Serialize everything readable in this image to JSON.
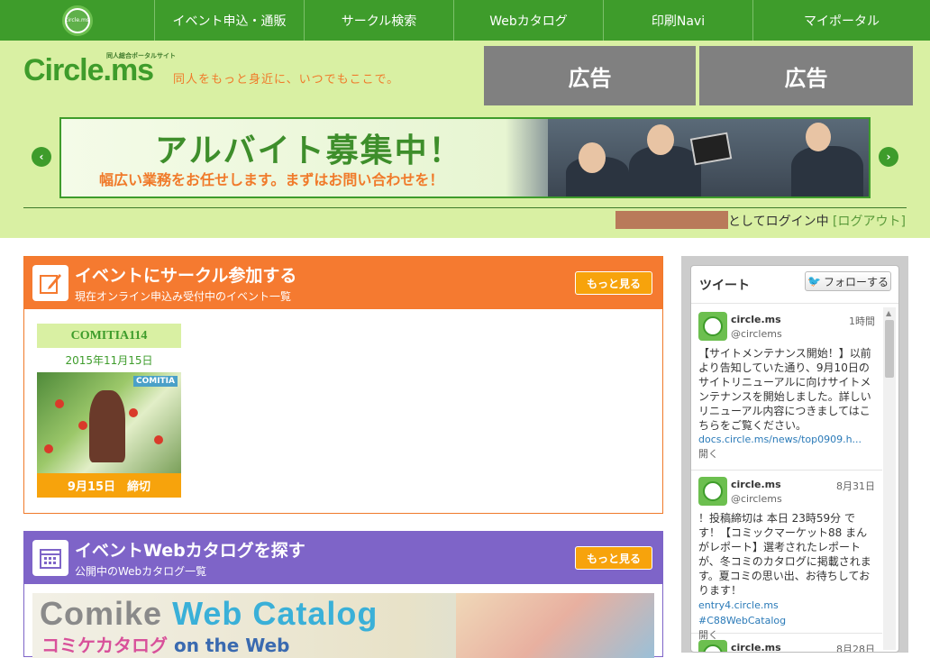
{
  "nav": {
    "logo_text": "circle.ms",
    "items": [
      {
        "label": "イベント申込・通販"
      },
      {
        "label": "サークル検索"
      },
      {
        "label": "Webカタログ"
      },
      {
        "label": "印刷Navi"
      },
      {
        "label": "マイポータル"
      }
    ]
  },
  "header": {
    "site_name": "Circle.ms",
    "site_sub": "同人総合ポータルサイト",
    "tagline": "同人をもっと身近に、いつでもここで。",
    "ads": [
      "広告",
      "広告"
    ],
    "banner_title": "アルバイト募集中！",
    "banner_sub": "幅広い業務をお任せします。まずはお問い合わせを！",
    "prev_arrow": "‹",
    "next_arrow": "›",
    "login_suffix": "としてログイン中",
    "logout_label": "[ログアウト]"
  },
  "event_section": {
    "title": "イベントにサークル参加する",
    "desc": "現在オンライン申込み受付中のイベント一覧",
    "more_label": "もっと見る",
    "event": {
      "name": "COMITIA114",
      "date": "2015年11月15日",
      "image_label": "COMITIA",
      "deadline": "9月15日　締切"
    }
  },
  "catalog_section": {
    "title": "イベントWebカタログを探す",
    "desc": "公開中のWebカタログ一覧",
    "more_label": "もっと見る",
    "banner_word1": "Comike",
    "banner_word2": "Web Catalog",
    "banner_sub1": "コミケカタログ",
    "banner_sub2": "on the Web"
  },
  "twitter": {
    "title": "ツイート",
    "follow_label": "フォローする",
    "tweets": [
      {
        "name": "circle.ms",
        "handle": "@circlems",
        "time": "1時間",
        "text": "【サイトメンテナンス開始！】以前より告知していた通り、9月10日のサイトリニューアルに向けサイトメンテナンスを開始しました。詳しいリニューアル内容につきましてはこちらをご覧ください。",
        "link": "docs.circle.ms/news/top0909.h...",
        "open": "開く"
      },
      {
        "name": "circle.ms",
        "handle": "@circlems",
        "time": "8月31日",
        "text": "！投稿締切は 本日 23時59分 です！【コミックマーケット88 まんがレポート】選考されたレポートが、冬コミのカタログに掲載されます。夏コミの思い出、お待ちしております！",
        "link": "entry4.circle.ms",
        "hashtag": "#C88WebCatalog",
        "open": "開く"
      },
      {
        "name": "circle.ms",
        "time": "8月28日"
      }
    ]
  },
  "colors": {
    "nav_green": "#3e9c2b",
    "header_bg": "#d9f0a3",
    "event_orange": "#f57a30",
    "catalog_purple": "#7e64c8",
    "more_button": "#f7a30c"
  }
}
